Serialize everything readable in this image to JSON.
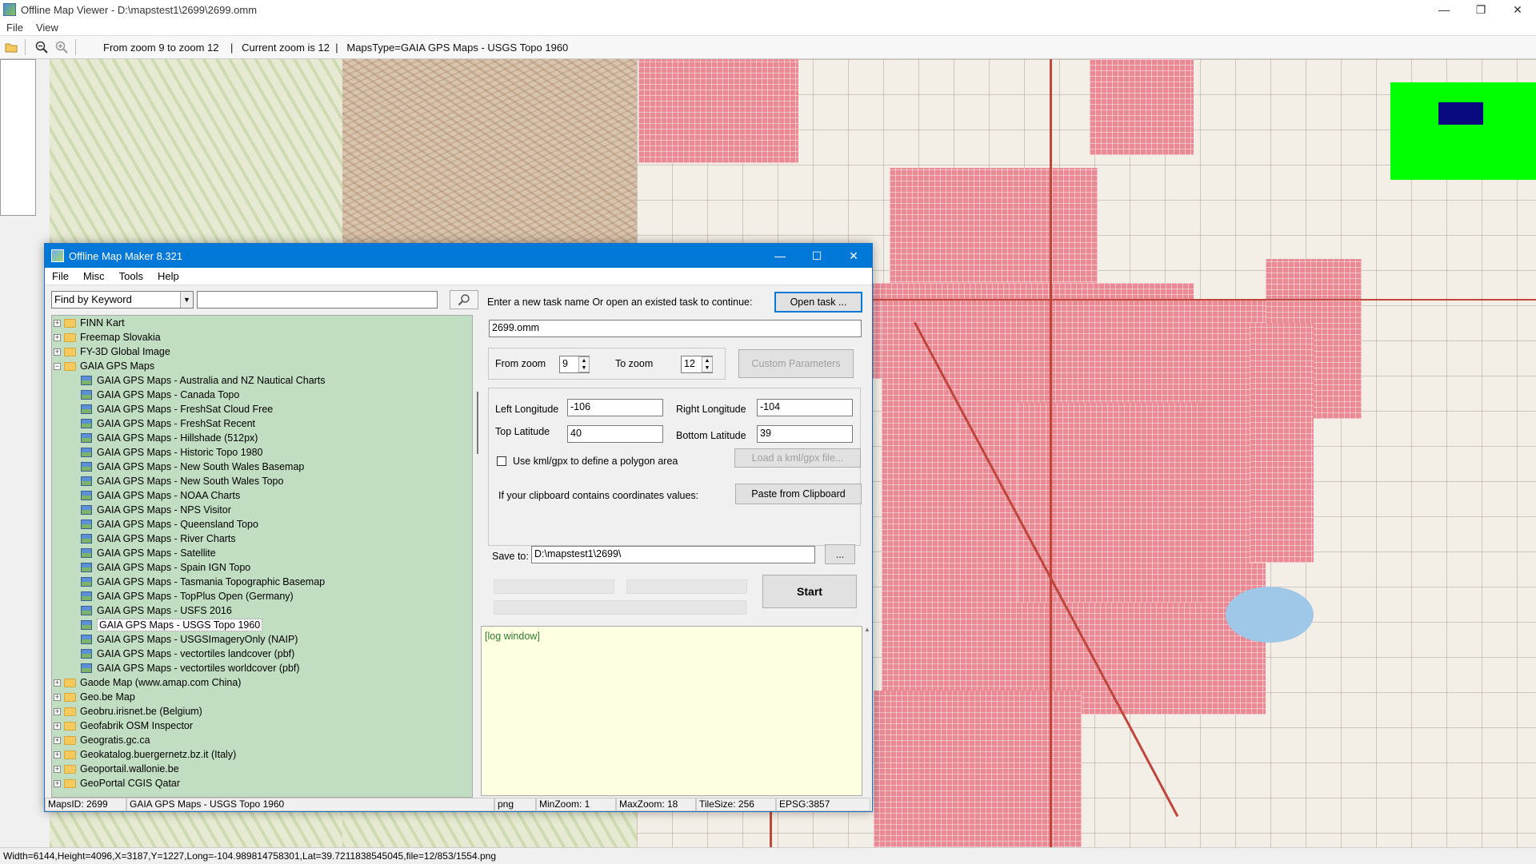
{
  "viewer": {
    "title": "Offline Map Viewer - D:\\mapstest1\\2699\\2699.omm",
    "menu": [
      "File",
      "View"
    ],
    "toolbar_status": "From zoom 9 to zoom 12    |   Current zoom is 12  |   MapsType=GAIA GPS Maps - USGS Topo 1960",
    "status_bar": "Width=6144,Height=4096,X=3187,Y=1227,Long=-104.989814758301,Lat=39.7211838545045,file=12/853/1554.png"
  },
  "window_controls": {
    "minimize": "—",
    "maximize": "☐",
    "restore": "❐",
    "close": "✕"
  },
  "icons": {
    "open": "open-folder-icon",
    "zoom_out": "zoom-out-icon",
    "zoom_in": "zoom-in-icon"
  },
  "dialog": {
    "title": "Offline Map Maker 8.321",
    "menu": [
      "File",
      "Misc",
      "Tools",
      "Help"
    ],
    "search": {
      "mode": "Find by Keyword",
      "value": ""
    },
    "tree": {
      "before": [
        "FINN Kart",
        "Freemap Slovakia",
        "FY-3D Global Image"
      ],
      "expanded": "GAIA GPS Maps",
      "children": [
        "GAIA GPS Maps - Australia and NZ Nautical Charts",
        "GAIA GPS Maps - Canada Topo",
        "GAIA GPS Maps - FreshSat Cloud Free",
        "GAIA GPS Maps - FreshSat Recent",
        "GAIA GPS Maps - Hillshade (512px)",
        "GAIA GPS Maps - Historic Topo 1980",
        "GAIA GPS Maps - New South Wales Basemap",
        "GAIA GPS Maps - New South Wales Topo",
        "GAIA GPS Maps - NOAA Charts",
        "GAIA GPS Maps - NPS Visitor",
        "GAIA GPS Maps - Queensland Topo",
        "GAIA GPS Maps - River Charts",
        "GAIA GPS Maps - Satellite",
        "GAIA GPS Maps - Spain IGN Topo",
        "GAIA GPS Maps - Tasmania Topographic Basemap",
        "GAIA GPS Maps - TopPlus Open (Germany)",
        "GAIA GPS Maps - USFS 2016",
        "GAIA GPS Maps - USGS Topo 1960",
        "GAIA GPS Maps - USGSImageryOnly (NAIP)",
        "GAIA GPS Maps - vectortiles landcover (pbf)",
        "GAIA GPS Maps - vectortiles worldcover (pbf)"
      ],
      "selected": "GAIA GPS Maps - USGS Topo 1960",
      "after": [
        "Gaode Map (www.amap.com China)",
        "Geo.be Map",
        "Geobru.irisnet.be (Belgium)",
        "Geofabrik OSM Inspector",
        "Geogratis.gc.ca",
        "Geokatalog.buergernetz.bz.it (Italy)",
        "Geoportail.wallonie.be",
        "GeoPortal CGIS Qatar"
      ]
    },
    "task_prompt": "Enter a new task name Or open an existed task to continue:",
    "open_task": "Open task ...",
    "task_name": "2699.omm",
    "from_zoom_label": "From zoom",
    "from_zoom": "9",
    "to_zoom_label": "To zoom",
    "to_zoom": "12",
    "custom_params": "Custom Parameters",
    "left_lon_label": "Left Longitude",
    "left_lon": "-106",
    "right_lon_label": "Right Longitude",
    "right_lon": "-104",
    "top_lat_label": "Top Latitude",
    "top_lat": "40",
    "bottom_lat_label": "Bottom Latitude",
    "bottom_lat": "39",
    "kml_label": "Use kml/gpx to define a polygon area",
    "kml_checked": false,
    "load_kml": "Load a kml/gpx file...",
    "clipboard_label": "If your clipboard contains coordinates values:",
    "paste": "Paste from Clipboard",
    "save_label": "Save to:",
    "save_path": "D:\\mapstest1\\2699\\",
    "browse": "...",
    "start": "Start",
    "log": "[log window]",
    "status": {
      "maps_id": "MapsID: 2699",
      "map_name": "GAIA GPS Maps - USGS Topo 1960",
      "format": "png",
      "min_zoom": "MinZoom: 1",
      "max_zoom": "MaxZoom: 18",
      "tile_size": "TileSize: 256",
      "epsg": "EPSG:3857"
    }
  },
  "colors": {
    "overview_bg": "#00ff00",
    "overview_rect": "#0a0a80",
    "tree_bg": "#c2dec2",
    "title_blue": "#0078d7",
    "urban": "#e98a95"
  }
}
